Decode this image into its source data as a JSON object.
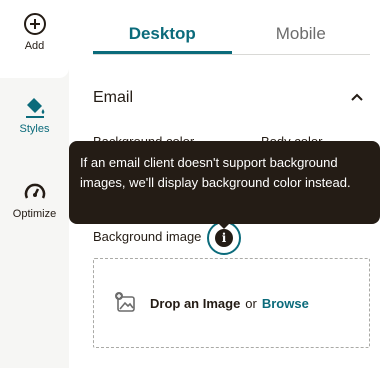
{
  "rail": {
    "add_label": "Add",
    "styles_label": "Styles",
    "optimize_label": "Optimize"
  },
  "tabs": {
    "desktop": "Desktop",
    "mobile": "Mobile",
    "active": "Desktop"
  },
  "section": {
    "title": "Email"
  },
  "fields": {
    "background_color": "Background color",
    "body_color": "Body color",
    "background_image": "Background image"
  },
  "dropzone": {
    "drop_label": "Drop an Image",
    "or_label": "or",
    "browse_label": "Browse"
  },
  "tooltip": {
    "text": "If an email client doesn't support background images, we'll display background color instead."
  },
  "colors": {
    "accent": "#0b6b7b",
    "dark": "#241c15",
    "rail_bg": "#f6f6f4"
  },
  "icons": {
    "add": "plus-circle-icon",
    "styles": "paint-bucket-icon",
    "optimize": "gauge-icon",
    "collapse": "chevron-up-icon",
    "info": "info-icon",
    "image": "add-image-icon"
  }
}
